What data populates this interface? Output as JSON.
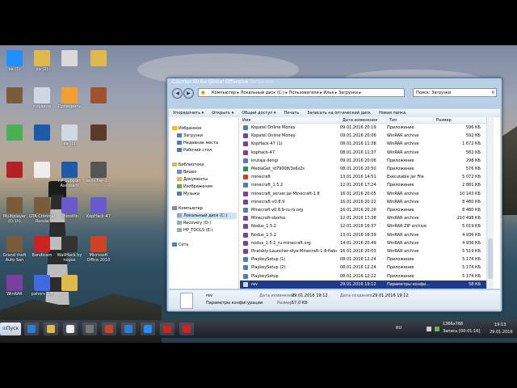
{
  "desktop": {
    "icons": [
      {
        "label": "ea (1)",
        "color": "#1e90ff"
      },
      {
        "label": "ea (2)",
        "color": "#e0b94d"
      },
      {
        "label": "",
        "color": "#d9d9d9"
      },
      {
        "label": "",
        "color": "#e0b94d"
      },
      {
        "label": "",
        "color": "#7b5c3a"
      },
      {
        "label": "Корзина",
        "color": "#cfd8e3"
      },
      {
        "label": "Проверить",
        "color": "#f0a030"
      },
      {
        "label": "",
        "color": "#a0522d"
      },
      {
        "label": "",
        "color": "#4caf50"
      },
      {
        "label": "",
        "color": "#1e5aa8"
      },
      {
        "label": "ea (1)",
        "color": "#cfd8e3"
      },
      {
        "label": "",
        "color": "#5a3a2a"
      },
      {
        "label": "",
        "color": "#b22222"
      },
      {
        "label": "",
        "color": "#eeeeee"
      },
      {
        "label": "HP Support Assistant",
        "color": "#1e5aa8"
      },
      {
        "label": "launcher-1...",
        "color": "#555555"
      },
      {
        "label": "Multiplayer (D:1h)",
        "color": "#7b5c3a"
      },
      {
        "label": "GTA Criminal Russia",
        "color": "#7b5c3a"
      },
      {
        "label": "Uninstlln",
        "color": "#6a5acd"
      },
      {
        "label": "KopHack-47",
        "color": "#6a5acd"
      },
      {
        "label": "Grand theft Auto San",
        "color": "#7b5c3a"
      },
      {
        "label": "Bandicam",
        "color": "#cc2222"
      },
      {
        "label": "WallHack by nopox",
        "color": "#333333"
      },
      {
        "label": "Microsoft Office 2010",
        "color": "#cc4422"
      },
      {
        "label": "WinRAR",
        "color": "#7b3fa0"
      },
      {
        "label": "pahors 1.8",
        "color": "#4169e1"
      },
      {
        "label": "",
        "color": "#e0b94d"
      }
    ]
  },
  "window": {
    "title": "Counter-Strike Global Offensive",
    "subtitle": "Загрузки",
    "address": "Компьютер ▸ Локальный диск (C:) ▸ Пользователи ▸ Илья ▸ Загрузки ▸",
    "search_placeholder": "Поиск: Загрузки",
    "toolbar": [
      "Упорядочить ▾",
      "Открыть ▾",
      "Общий доступ ▾",
      "Печать",
      "Записать на оптический диск",
      "Новая папка"
    ],
    "nav": [
      {
        "label": "Избранное",
        "color": "#f2c200",
        "indent": 0,
        "sel": false
      },
      {
        "label": "Загрузки",
        "color": "#4a7fbf",
        "indent": 1,
        "sel": false
      },
      {
        "label": "Недавние места",
        "color": "#4a7fbf",
        "indent": 1,
        "sel": false
      },
      {
        "label": "Рабочий стол",
        "color": "#3a7ad8",
        "indent": 1,
        "sel": false
      },
      {
        "label": "",
        "color": "",
        "indent": 0,
        "sel": false
      },
      {
        "label": "Библиотеки",
        "color": "#e0b94d",
        "indent": 0,
        "sel": false
      },
      {
        "label": "Видео",
        "color": "#6a8fc0",
        "indent": 1,
        "sel": false
      },
      {
        "label": "Документы",
        "color": "#e0b94d",
        "indent": 1,
        "sel": false
      },
      {
        "label": "Изображения",
        "color": "#6aa84f",
        "indent": 1,
        "sel": false
      },
      {
        "label": "Музыка",
        "color": "#4a7fbf",
        "indent": 1,
        "sel": false
      },
      {
        "label": "",
        "color": "",
        "indent": 0,
        "sel": false
      },
      {
        "label": "Компьютер",
        "color": "#7a8fa8",
        "indent": 0,
        "sel": false
      },
      {
        "label": "Локальный диск (C:)",
        "color": "#9aa7b5",
        "indent": 1,
        "sel": true
      },
      {
        "label": "Recovery (D:)",
        "color": "#9aa7b5",
        "indent": 1,
        "sel": false
      },
      {
        "label": "HP_TOOLS (E:)",
        "color": "#9aa7b5",
        "indent": 1,
        "sel": false
      },
      {
        "label": "",
        "color": "",
        "indent": 0,
        "sel": false
      },
      {
        "label": "Сеть",
        "color": "#4a7fbf",
        "indent": 0,
        "sel": false
      }
    ],
    "columns": [
      "Имя",
      "Дата изменения",
      "Тип",
      "Размер"
    ],
    "files": [
      {
        "name": "Kopatel Online Money",
        "date": "09.01.2016 20:19",
        "type": "Приложение",
        "size": "596 КБ",
        "color": "#4a7fbf",
        "sel": false
      },
      {
        "name": "Kopatel Online Money",
        "date": "09.01.2016 20:06",
        "type": "WinRAR archive",
        "size": "592 КБ",
        "color": "#7b3fa0",
        "sel": false
      },
      {
        "name": "KopHack-47 (1)",
        "date": "08.01.2016 11:38",
        "type": "WinRAR archive",
        "size": "1 672 КБ",
        "color": "#7b3fa0",
        "sel": false
      },
      {
        "name": "kophack-47",
        "date": "08.01.2016 11:37",
        "type": "WinRAR archive",
        "size": "582 КБ",
        "color": "#7b3fa0",
        "sel": false
      },
      {
        "name": "krutaja dengi",
        "date": "09.01.2016 20:06",
        "type": "Приложение",
        "size": "298 КБ",
        "color": "#4a7fbf",
        "sel": false
      },
      {
        "name": "MediaGet_id79008/3s6s2s",
        "date": "08.01.2016 20:50",
        "type": "Приложение",
        "size": "576 КБ",
        "color": "#2e8b57",
        "sel": false
      },
      {
        "name": "minecraft",
        "date": "13.01.2016 14:51",
        "type": "Executable Jar File",
        "size": "5 072 КБ",
        "color": "#d04020",
        "sel": false
      },
      {
        "name": "minecraft_1.5.2",
        "date": "12.01.2016 17:24",
        "type": "Приложение",
        "size": "2 881 КБ",
        "color": "#4a7fbf",
        "sel": false
      },
      {
        "name": "minecraft_server.jar-Minecraft-1.8",
        "date": "16.01.2016 20:05",
        "type": "WinRAR archive",
        "size": "10 143 КБ",
        "color": "#7b3fa0",
        "sel": false
      },
      {
        "name": "minecraft-v0.8.9",
        "date": "16.01.2016 20:22",
        "type": "WinRAR archive",
        "size": "8 480 КБ",
        "color": "#7b3fa0",
        "sel": false
      },
      {
        "name": "Minecraft-v0.8.9-ru-rs.org",
        "date": "16.01.2016 20:26",
        "type": "Приложение",
        "size": "8 480 КБ",
        "color": "#4a7fbf",
        "sel": false
      },
      {
        "name": "Minecraft-sborka",
        "date": "12.01.2016 17:38",
        "type": "WinRAR archive",
        "size": "210 498 КБ",
        "color": "#7b3fa0",
        "sel": false
      },
      {
        "name": "Nodus_1.5.2",
        "date": "12.01.2016 16:37",
        "type": "WinRAR ZIP archive",
        "size": "5 019 КБ",
        "color": "#7b3fa0",
        "sel": false
      },
      {
        "name": "Nodus_1.5.2",
        "date": "13.01.2016 16:39",
        "type": "WinRAR archive",
        "size": "4 936 КБ",
        "color": "#7b3fa0",
        "sel": false
      },
      {
        "name": "nodus_1.5.2_ru-minecraft.org",
        "date": "14.01.2016 20:49",
        "type": "WinRAR archive",
        "size": "4 936 КБ",
        "color": "#7b3fa0",
        "sel": false
      },
      {
        "name": "Piratskiy-Launcher-dlya-Minecraft-1.8-flabo...",
        "date": "16.01.2016 20:03",
        "type": "WinRAR archive",
        "size": "5 519 КБ",
        "color": "#7b3fa0",
        "sel": false
      },
      {
        "name": "PlaykeySetup (1)",
        "date": "08.01.2016 12:24",
        "type": "Приложение",
        "size": "5 174 КБ",
        "color": "#4a7fbf",
        "sel": false
      },
      {
        "name": "PlaykeySetup (2)",
        "date": "08.01.2016 12:24",
        "type": "Приложение",
        "size": "5 174 КБ",
        "color": "#4a7fbf",
        "sel": false
      },
      {
        "name": "PlaykeySetup",
        "date": "08.01.2016 12:22",
        "type": "Приложение",
        "size": "5 174 КБ",
        "color": "#4a7fbf",
        "sel": false
      },
      {
        "name": "rev",
        "date": "29.01.2016 19:12",
        "type": "Параметры конфи...",
        "size": "58 КБ",
        "color": "#cfd8e3",
        "sel": true
      }
    ],
    "details": {
      "name": "rev",
      "type": "Параметры конфигурации",
      "modified_label": "Дата изменения:",
      "modified": "29.01.2016 19:12",
      "size_label": "Размер:",
      "size": "57,0 КБ",
      "created_label": "Дата создания:",
      "created": "29.01.2016 19:12"
    }
  },
  "taskbar": {
    "start_label": "Пуск",
    "apps": [
      "#2a7fd4",
      "#e0b94d",
      "#eeeeee",
      "#777777",
      "#cc4422",
      "#2a7fd4",
      "#1e90ff",
      "#cc2222",
      "#cc2222"
    ],
    "lang": "RU",
    "resolution": "1366x768",
    "recording": "Запись [00:01:16]",
    "time": "19:13",
    "date": "29.01.2016"
  }
}
